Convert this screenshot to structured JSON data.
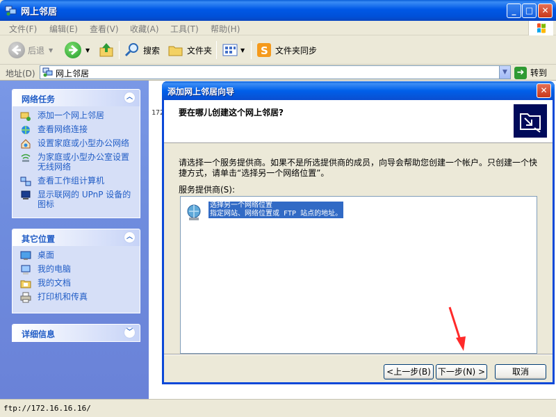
{
  "window": {
    "title": "网上邻居",
    "controls": {
      "minimize": "_",
      "maximize": "□",
      "close": "✕"
    }
  },
  "menu": {
    "items": [
      {
        "label": "文件(F)"
      },
      {
        "label": "编辑(E)"
      },
      {
        "label": "查看(V)"
      },
      {
        "label": "收藏(A)"
      },
      {
        "label": "工具(T)"
      },
      {
        "label": "帮助(H)"
      }
    ]
  },
  "toolbar": {
    "back_label": "后退",
    "search_label": "搜索",
    "folders_label": "文件夹",
    "sync_label": "文件夹同步"
  },
  "address": {
    "label": "地址(D)",
    "value": "网上邻居",
    "go_label": "转到"
  },
  "network_tasks": {
    "title": "网络任务",
    "items": [
      {
        "label": "添加一个网上邻居",
        "icon": "add-network-place-icon"
      },
      {
        "label": "查看网络连接",
        "icon": "network-connections-icon"
      },
      {
        "label": "设置家庭或小型办公网络",
        "icon": "home-network-icon"
      },
      {
        "label": "为家庭或小型办公室设置无线网络",
        "icon": "wireless-network-icon"
      },
      {
        "label": "查看工作组计算机",
        "icon": "workgroup-computers-icon"
      },
      {
        "label": "显示联网的 UPnP 设备的图标",
        "icon": "upnp-devices-icon"
      }
    ]
  },
  "other_places": {
    "title": "其它位置",
    "items": [
      {
        "label": "桌面",
        "icon": "desktop-icon"
      },
      {
        "label": "我的电脑",
        "icon": "my-computer-icon"
      },
      {
        "label": "我的文档",
        "icon": "my-documents-icon"
      },
      {
        "label": "打印机和传真",
        "icon": "printers-icon"
      }
    ]
  },
  "details": {
    "title": "详细信息"
  },
  "content": {
    "ip_fragment": "172"
  },
  "status": {
    "text": "ftp://172.16.16.16/"
  },
  "dialog": {
    "title": "添加网上邻居向导",
    "heading": "要在哪儿创建这个网上邻居?",
    "intro": "请选择一个服务提供商。如果不是所选提供商的成员，向导会帮助您创建一个帐户。只创建一个快捷方式，请单击“选择另一个网络位置”。",
    "list_label": "服务提供商(S):",
    "list_item_title": "选择另一个网络位置",
    "list_item_desc": "指定网站、网络位置或 FTP 站点的地址。",
    "back_button": "<上一步(B)",
    "next_button": "下一步(N) >",
    "cancel_button": "取消"
  },
  "colors": {
    "titlebar": "#0058e6",
    "taskpane_bg": "#6f8dde",
    "link": "#215dc6",
    "selection": "#316ac5",
    "annotation_arrow": "#ff2a2a"
  }
}
